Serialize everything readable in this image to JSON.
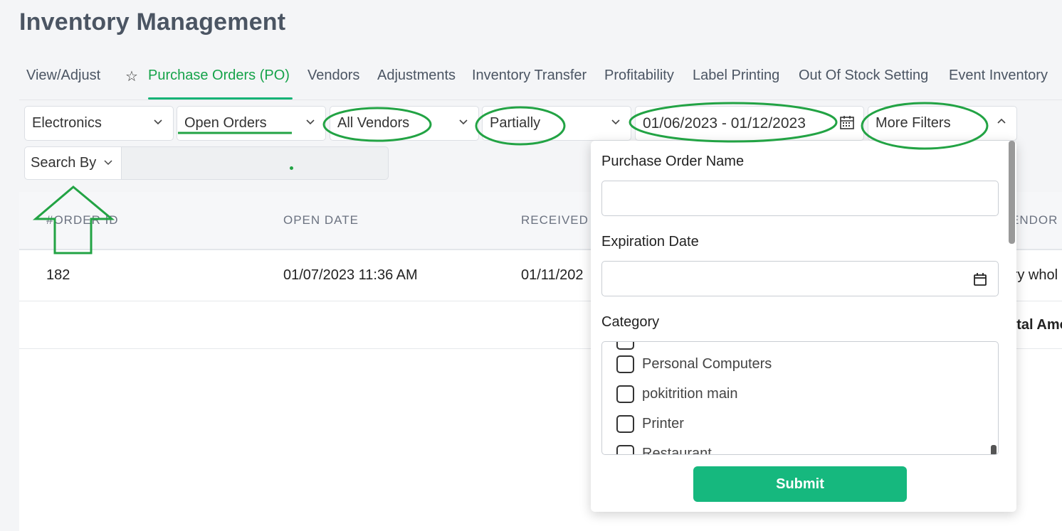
{
  "page": {
    "title": "Inventory Management"
  },
  "tabs": [
    {
      "label": "View/Adjust"
    },
    {
      "label": "Purchase Orders (PO)",
      "active": true
    },
    {
      "label": "Vendors"
    },
    {
      "label": "Adjustments"
    },
    {
      "label": "Inventory Transfer"
    },
    {
      "label": "Profitability"
    },
    {
      "label": "Label Printing"
    },
    {
      "label": "Out Of Stock Setting"
    },
    {
      "label": "Event Inventory"
    }
  ],
  "filters": {
    "category": "Electronics",
    "status": "Open Orders",
    "vendor": "All Vendors",
    "receive_status": "Partially",
    "date_range": "01/06/2023 - 01/12/2023",
    "more_filters": "More Filters"
  },
  "search": {
    "search_by": "Search By",
    "value": ""
  },
  "table": {
    "headers": [
      "#ORDER ID",
      "OPEN DATE",
      "RECEIVED D",
      "ENDOR"
    ],
    "rows": [
      {
        "order_id": "182",
        "open_date": "01/07/2023 11:36 AM",
        "received_date": "01/11/202",
        "vendor": "rry whol"
      }
    ],
    "footer_label": "otal Amo"
  },
  "more_filters_panel": {
    "po_name_label": "Purchase Order Name",
    "po_name_value": "",
    "expiration_label": "Expiration Date",
    "expiration_value": "",
    "category_label": "Category",
    "categories": [
      "Personal Computers",
      "pokitrition main",
      "Printer",
      "Restaurant"
    ],
    "submit_label": "Submit"
  },
  "colors": {
    "accent": "#16b87e",
    "active_tab": "#16a34a",
    "annotation": "#22a344"
  },
  "icons": [
    "star-icon",
    "chevron-down-icon",
    "chevron-up-icon",
    "calendar-icon"
  ]
}
